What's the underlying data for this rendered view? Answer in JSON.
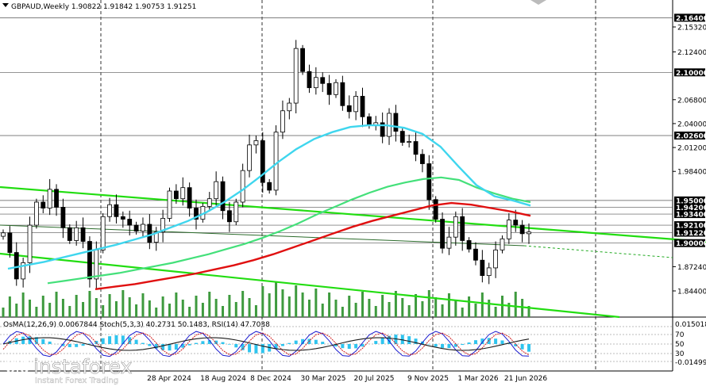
{
  "header": {
    "symbol_line": "GBPAUD,Weekly  1.90822 1.91842 1.90753 1.91251",
    "indicator_line": "OsMA(12,26,9) 0.0067844  Stoch(5,3,3) 40.2731 50.1483, RSI(14) 47.7038"
  },
  "watermark": {
    "brand": "instaforex",
    "tagline": "Instant Forex Trading"
  },
  "colors": {
    "candles": "#000000",
    "ema_cyan": "#3fd6ee",
    "ema_green": "#44e07a",
    "ema_red": "#e01010",
    "trend_green": "#22dd11",
    "trend_dark": "#2b6b2b",
    "volume": "#3e9a3e",
    "level_tag_bg": "#000000",
    "osma_bars": "#2fc4ee",
    "stoch_main": "#1c1cd0",
    "stoch_signal": "#d01c1c",
    "rsi": "#1a1a1a"
  },
  "chart_data": {
    "type": "line",
    "title": "GBPAUD,Weekly",
    "x_labels": [
      "28 Apr 2024",
      "18 Aug 2024",
      "8 Dec 2024",
      "30 Mar 2025",
      "20 Jul 2025",
      "9 Nov 2025",
      "1 Mar 2026",
      "21 Jun 2026"
    ],
    "y_ticks": [
      "2.15320",
      "2.12400",
      "2.06800",
      "2.04000",
      "2.01200",
      "1.98400",
      "1.87240",
      "1.84400"
    ],
    "ylim": [
      1.838,
      2.176
    ],
    "level_tags": [
      "2.16400",
      "2.10000",
      "2.02600",
      "1.95000",
      "1.94200",
      "1.93400",
      "1.92100",
      "1.91220",
      "1.90000"
    ],
    "price_close": [
      1.912,
      1.889,
      1.858,
      1.877,
      1.921,
      1.948,
      1.941,
      1.963,
      1.942,
      1.918,
      1.903,
      1.918,
      1.902,
      1.858,
      1.892,
      1.931,
      1.945,
      1.931,
      1.928,
      1.921,
      1.914,
      1.922,
      1.901,
      1.913,
      1.929,
      1.961,
      1.952,
      1.965,
      1.941,
      1.928,
      1.943,
      1.952,
      1.972,
      1.938,
      1.925,
      1.948,
      1.985,
      2.015,
      2.02,
      1.971,
      1.962,
      2.03,
      2.055,
      2.064,
      2.128,
      2.101,
      2.082,
      2.094,
      2.087,
      2.074,
      2.088,
      2.061,
      2.054,
      2.072,
      2.048,
      2.038,
      2.041,
      2.025,
      2.052,
      2.031,
      2.018,
      2.019,
      2.004,
      1.993,
      1.951,
      1.928,
      1.894,
      1.907,
      1.931,
      1.903,
      1.893,
      1.88,
      1.862,
      1.871,
      1.892,
      1.905,
      1.927,
      1.921,
      1.911,
      1.913
    ],
    "ema_cyan": [
      1.87,
      1.874,
      1.878,
      1.883,
      1.888,
      1.893,
      1.898,
      1.904,
      1.91,
      1.918,
      1.926,
      1.936,
      1.948,
      1.962,
      1.978,
      1.995,
      2.01,
      2.022,
      2.03,
      2.036,
      2.038,
      2.038,
      2.035,
      2.028,
      2.013,
      1.99,
      1.968,
      1.955,
      1.95,
      1.944
    ],
    "ema_green": [
      1.853,
      1.856,
      1.859,
      1.862,
      1.865,
      1.869,
      1.873,
      1.877,
      1.882,
      1.887,
      1.893,
      1.899,
      1.906,
      1.914,
      1.923,
      1.933,
      1.942,
      1.951,
      1.959,
      1.966,
      1.971,
      1.975,
      1.977,
      1.974,
      1.965,
      1.958,
      1.952,
      1.948
    ],
    "ema_red": [
      1.846,
      1.849,
      1.852,
      1.856,
      1.86,
      1.864,
      1.869,
      1.874,
      1.88,
      1.887,
      1.895,
      1.903,
      1.911,
      1.919,
      1.926,
      1.932,
      1.938,
      1.944,
      1.947,
      1.945,
      1.941,
      1.937,
      1.932
    ]
  }
}
